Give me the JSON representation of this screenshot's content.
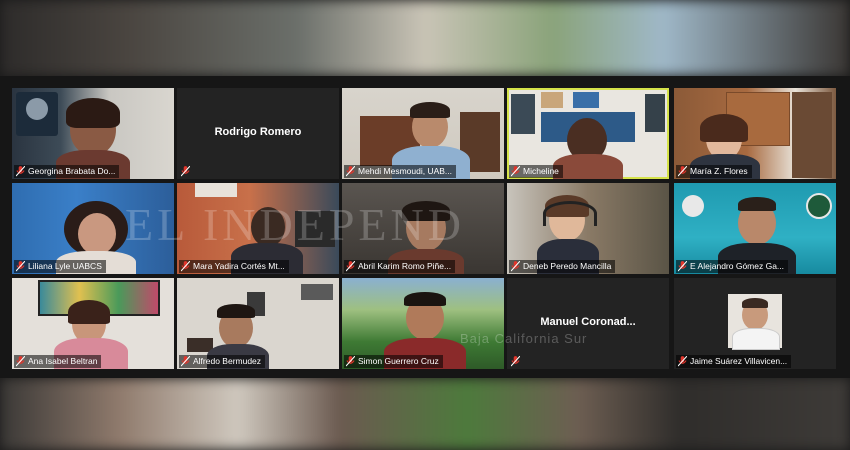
{
  "meeting": {
    "participants": [
      {
        "name": "Georgina Brabata Do..."
      },
      {
        "name": "Rodrigo Romero",
        "center_name": "Rodrigo Romero"
      },
      {
        "name": "Mehdi Mesmoudi, UAB..."
      },
      {
        "name": "Micheline",
        "active": true
      },
      {
        "name": "María Z. Flores"
      },
      {
        "name": "Liliana Lyle UABCS"
      },
      {
        "name": "Mara Yadira Cortés Mt..."
      },
      {
        "name": "Abril Karim Romo Piñe..."
      },
      {
        "name": "Deneb Peredo Mancilla"
      },
      {
        "name": "E Alejandro Gómez Ga..."
      },
      {
        "name": "Ana Isabel Beltran"
      },
      {
        "name": "Alfredo Bermudez"
      },
      {
        "name": "Simon Guerrero Cruz"
      },
      {
        "name": "",
        "center_name": "Manuel  Coronad..."
      },
      {
        "name": "Jaime Suárez Villavicen..."
      }
    ],
    "active_color": "#d6e34a",
    "mic_muted_color": "#e0352b"
  },
  "watermark": {
    "text": "EL INDEPEND",
    "subtext": "Baja California Sur"
  }
}
